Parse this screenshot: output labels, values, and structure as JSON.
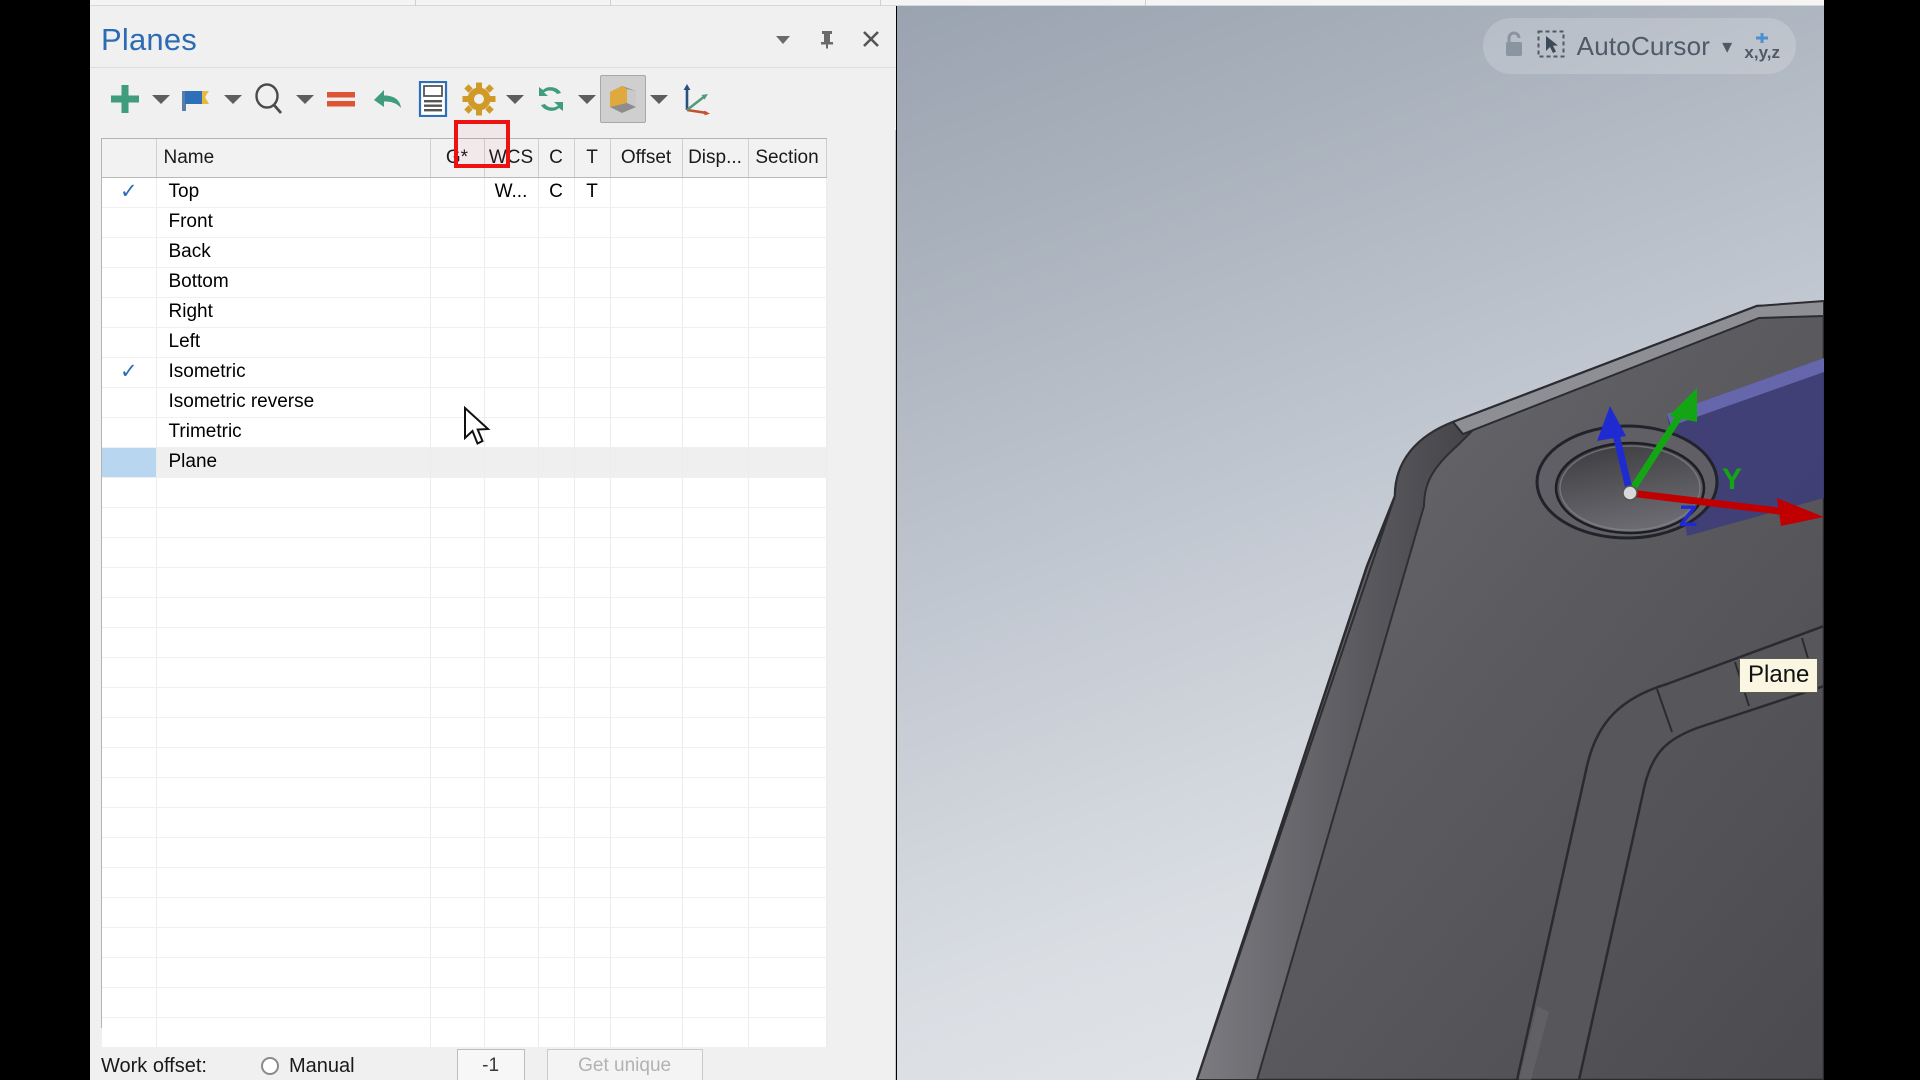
{
  "window": {
    "title": "Planes",
    "controls": [
      {
        "name": "dropdown-arrow",
        "label": "▾"
      },
      {
        "name": "pin",
        "label": "pin"
      },
      {
        "name": "close",
        "label": "×"
      }
    ]
  },
  "toolbar": {
    "items": [
      {
        "name": "add-plane-button",
        "icon": "plus-icon",
        "label": "Create new plane"
      },
      {
        "name": "add-plane-dropdown",
        "icon": "chevron-down-icon",
        "label": ""
      },
      {
        "name": "flag-button",
        "icon": "flag-icon",
        "label": "Set plane"
      },
      {
        "name": "flag-dropdown",
        "icon": "chevron-down-icon",
        "label": ""
      },
      {
        "name": "find-button",
        "icon": "magnifier-icon",
        "label": "Find plane"
      },
      {
        "name": "find-dropdown",
        "icon": "chevron-down-icon",
        "label": ""
      },
      {
        "name": "equal-button",
        "icon": "equals-icon",
        "label": "Equal"
      },
      {
        "name": "undo-button",
        "icon": "undo-arrow-icon",
        "label": "Undo"
      },
      {
        "name": "properties-button",
        "icon": "list-panel-icon",
        "label": "Properties"
      },
      {
        "name": "settings-button",
        "icon": "gear-icon",
        "label": "Settings"
      },
      {
        "name": "settings-dropdown",
        "icon": "chevron-down-icon",
        "label": ""
      },
      {
        "name": "refresh-button",
        "icon": "refresh-icon",
        "label": "Refresh"
      },
      {
        "name": "refresh-dropdown",
        "icon": "chevron-down-icon",
        "label": ""
      },
      {
        "name": "view-cube-button",
        "icon": "cube-icon",
        "label": "Display view",
        "pressed": true
      },
      {
        "name": "view-cube-dropdown",
        "icon": "chevron-down-icon",
        "label": ""
      },
      {
        "name": "axis-gnomon-button",
        "icon": "axes-icon",
        "label": "Show axes"
      }
    ]
  },
  "table": {
    "columns": [
      {
        "key": "check",
        "label": ""
      },
      {
        "key": "name",
        "label": "Name"
      },
      {
        "key": "g",
        "label": "G*"
      },
      {
        "key": "wcs",
        "label": "WCS"
      },
      {
        "key": "c",
        "label": "C"
      },
      {
        "key": "t",
        "label": "T"
      },
      {
        "key": "offset",
        "label": "Offset"
      },
      {
        "key": "disp",
        "label": "Disp..."
      },
      {
        "key": "section",
        "label": "Section"
      }
    ],
    "rows": [
      {
        "check": "✓",
        "name": "Top",
        "g": "",
        "wcs": "W...",
        "c": "C",
        "t": "T",
        "offset": "",
        "disp": "",
        "section": "",
        "selected": false
      },
      {
        "check": "",
        "name": "Front",
        "g": "",
        "wcs": "",
        "c": "",
        "t": "",
        "offset": "",
        "disp": "",
        "section": "",
        "selected": false
      },
      {
        "check": "",
        "name": "Back",
        "g": "",
        "wcs": "",
        "c": "",
        "t": "",
        "offset": "",
        "disp": "",
        "section": "",
        "selected": false
      },
      {
        "check": "",
        "name": "Bottom",
        "g": "",
        "wcs": "",
        "c": "",
        "t": "",
        "offset": "",
        "disp": "",
        "section": "",
        "selected": false
      },
      {
        "check": "",
        "name": "Right",
        "g": "",
        "wcs": "",
        "c": "",
        "t": "",
        "offset": "",
        "disp": "",
        "section": "",
        "selected": false
      },
      {
        "check": "",
        "name": "Left",
        "g": "",
        "wcs": "",
        "c": "",
        "t": "",
        "offset": "",
        "disp": "",
        "section": "",
        "selected": false
      },
      {
        "check": "✓",
        "name": "Isometric",
        "g": "",
        "wcs": "",
        "c": "",
        "t": "",
        "offset": "",
        "disp": "",
        "section": "",
        "selected": false
      },
      {
        "check": "",
        "name": "Isometric reverse",
        "g": "",
        "wcs": "",
        "c": "",
        "t": "",
        "offset": "",
        "disp": "",
        "section": "",
        "selected": false
      },
      {
        "check": "",
        "name": "Trimetric",
        "g": "",
        "wcs": "",
        "c": "",
        "t": "",
        "offset": "",
        "disp": "",
        "section": "",
        "selected": false
      },
      {
        "check": "",
        "name": "Plane",
        "g": "",
        "wcs": "",
        "c": "",
        "t": "",
        "offset": "",
        "disp": "",
        "section": "",
        "selected": true
      }
    ],
    "empty_rows": 19
  },
  "annotation": {
    "name": "g-column-highlight",
    "color": "#ee1111"
  },
  "work_offset": {
    "label": "Work offset:",
    "manual_label": "Manual",
    "manual_checked": false,
    "value": "-1",
    "get_unique_label": "Get unique"
  },
  "viewport": {
    "autocursor": {
      "lock_icon": "lock-icon",
      "cursor_icon": "cursor-select-icon",
      "label": "AutoCursor",
      "dropdown": "▾",
      "xyz_label": "x,y,z"
    },
    "gizmo": {
      "x_axis_color": "#c00000",
      "y_axis_label": "Y",
      "y_axis_color": "#13a513",
      "z_axis_label": "Z",
      "z_axis_color": "#1f2bd0"
    },
    "plane_tooltip": "Plane",
    "model_color": "#5a5a5e",
    "plane_face_color": "#3c3c7a"
  }
}
